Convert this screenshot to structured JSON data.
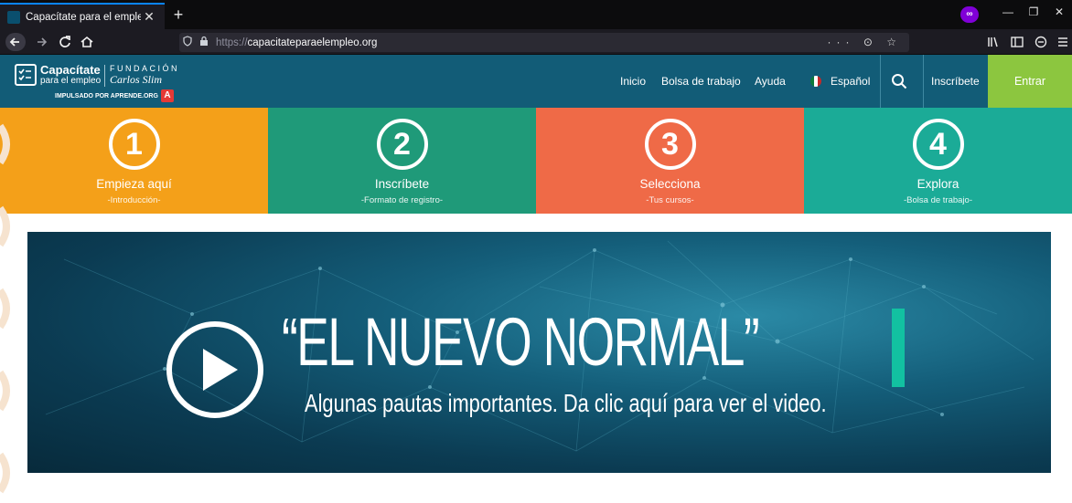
{
  "browser": {
    "tab_title": "Capacítate para el empleo",
    "url_scheme": "https://",
    "url_host": "capacitateparaelempleo.org",
    "url_actions": "··· ⊙ ☆"
  },
  "site": {
    "logo": {
      "brand_line1": "Capacítate",
      "brand_line2": "para el empleo",
      "fundacion": "FUNDACIÓN",
      "signature": "Carlos Slim",
      "powered_by": "IMPULSADO POR APRENDE.ORG",
      "badge": "A"
    },
    "nav": {
      "inicio": "Inicio",
      "bolsa": "Bolsa de trabajo",
      "ayuda": "Ayuda",
      "idioma": "Español",
      "inscribete": "Inscríbete",
      "entrar": "Entrar"
    },
    "steps": [
      {
        "number": "1",
        "title": "Empieza aquí",
        "subtitle": "-Introducción-",
        "color": "#f4a019"
      },
      {
        "number": "2",
        "title": "Inscríbete",
        "subtitle": "-Formato de registro-",
        "color": "#1f9a79"
      },
      {
        "number": "3",
        "title": "Selecciona",
        "subtitle": "-Tus cursos-",
        "color": "#ef6a47"
      },
      {
        "number": "4",
        "title": "Explora",
        "subtitle": "-Bolsa de trabajo-",
        "color": "#1bab97"
      }
    ],
    "banner": {
      "headline": "“EL NUEVO NORMAL”",
      "subline": "Algunas pautas importantes. Da clic aquí para ver el video."
    }
  },
  "colors": {
    "header_bg": "#125c77",
    "entrar_bg": "#8cc63f",
    "accent_cursor": "#12c1a1"
  }
}
